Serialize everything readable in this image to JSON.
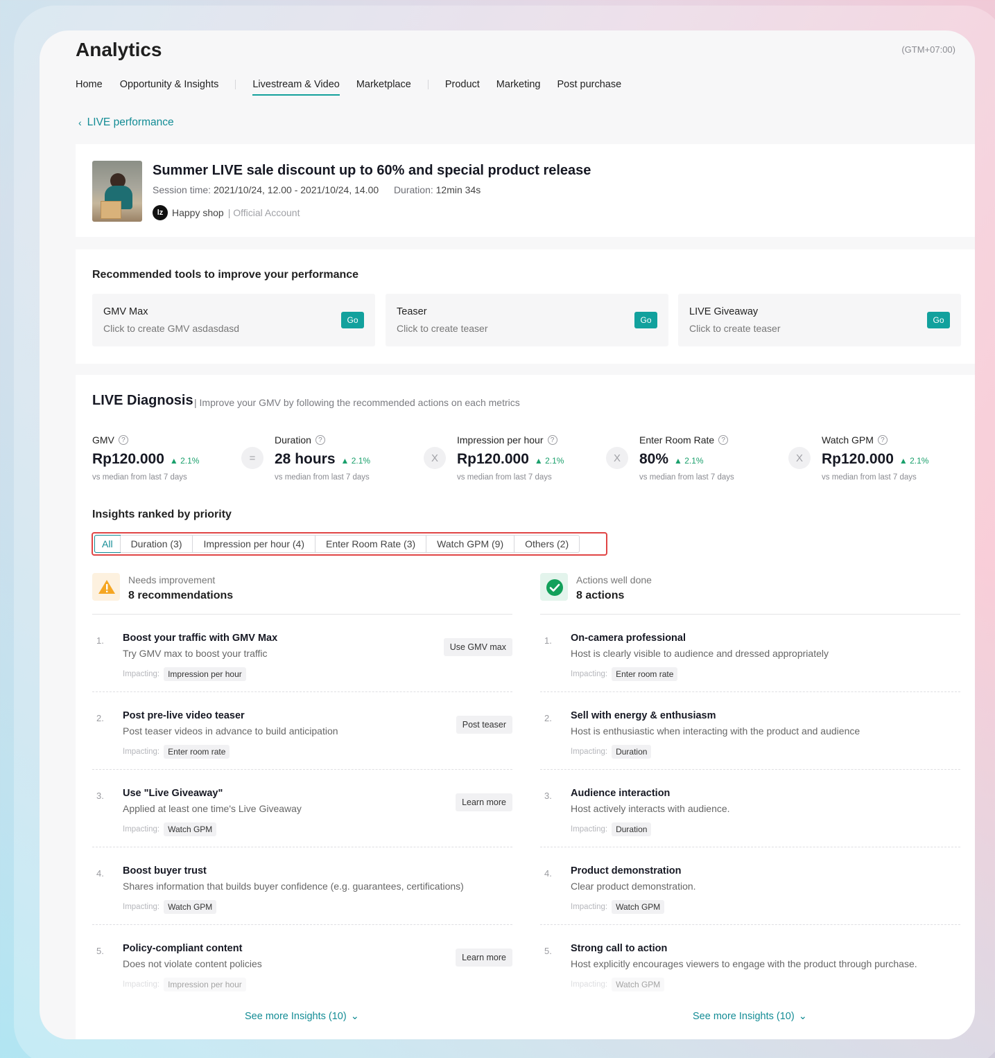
{
  "app": {
    "title": "Analytics",
    "timezone": "(GTM+07:00)"
  },
  "nav": {
    "home": "Home",
    "opportunity": "Opportunity & Insights",
    "livestream": "Livestream & Video",
    "marketplace": "Marketplace",
    "product": "Product",
    "marketing": "Marketing",
    "post_purchase": "Post purchase",
    "active": "Livestream & Video"
  },
  "back": {
    "label": "LIVE performance"
  },
  "session": {
    "title": "Summer LIVE sale discount up to 60% and special product release",
    "time_label": "Session time:",
    "time_value": "2021/10/24, 12.00 - 2021/10/24, 14.00",
    "duration_label": "Duration:",
    "duration_value": "12min 34s",
    "shop_logo": "lz",
    "shop_name": "Happy shop",
    "shop_type": "| Official Account"
  },
  "tools": {
    "title": "Recommended tools to improve your performance",
    "items": [
      {
        "name": "GMV Max",
        "desc": "Click to create GMV asdasdasd",
        "button": "Go"
      },
      {
        "name": "Teaser",
        "desc": "Click to create teaser",
        "button": "Go"
      },
      {
        "name": "LIVE Giveaway",
        "desc": "Click to create teaser",
        "button": "Go"
      }
    ]
  },
  "diagnosis": {
    "title": "LIVE Diagnosis",
    "subtitle": "| Improve your GMV by following the recommended actions on each metrics",
    "metrics": [
      {
        "label": "GMV",
        "value": "Rp120.000",
        "change": "▲ 2.1%",
        "note": "vs median from last 7 days"
      },
      {
        "label": "Duration",
        "value": "28 hours",
        "change": "▲ 2.1%",
        "note": "vs median from last 7 days"
      },
      {
        "label": "Impression per hour",
        "value": "Rp120.000",
        "change": "▲ 2.1%",
        "note": "vs median from last 7 days"
      },
      {
        "label": "Enter Room Rate",
        "value": "80%",
        "change": "▲ 2.1%",
        "note": "vs median from last 7 days"
      },
      {
        "label": "Watch GPM",
        "value": "Rp120.000",
        "change": "▲ 2.1%",
        "note": "vs median from last 7 days"
      }
    ],
    "operators": [
      "=",
      "X",
      "X",
      "X"
    ],
    "help_icon": "?"
  },
  "insights": {
    "title": "Insights ranked by priority",
    "filters": [
      "All",
      "Duration (3)",
      "Impression per hour (4)",
      "Enter Room Rate (3)",
      "Watch GPM (9)",
      "Others (2)"
    ],
    "impacting_label": "Impacting:",
    "left": {
      "sub": "Needs improvement",
      "count": "8 recommendations",
      "items": [
        {
          "num": "1.",
          "title": "Boost your traffic with GMV Max",
          "desc": "Try GMV max to boost your traffic",
          "tag": "Impression per hour",
          "button": "Use GMV max"
        },
        {
          "num": "2.",
          "title": "Post pre-live video teaser",
          "desc": "Post teaser videos in advance to build anticipation",
          "tag": "Enter room rate",
          "button": "Post teaser"
        },
        {
          "num": "3.",
          "title": "Use \"Live Giveaway\"",
          "desc": "Applied at least one time's Live Giveaway",
          "tag": "Watch GPM",
          "button": "Learn more"
        },
        {
          "num": "4.",
          "title": "Boost buyer trust",
          "desc": "Shares information that builds buyer confidence (e.g. guarantees, certifications)",
          "tag": "Watch GPM",
          "button": ""
        },
        {
          "num": "5.",
          "title": "Policy-compliant content",
          "desc": "Does not violate content policies",
          "tag": "Impression per hour",
          "button": "Learn more"
        }
      ],
      "see_more": "See more Insights (10)"
    },
    "right": {
      "sub": "Actions well done",
      "count": "8 actions",
      "items": [
        {
          "num": "1.",
          "title": "On-camera professional",
          "desc": "Host is clearly visible to audience and dressed appropriately",
          "tag": "Enter room rate"
        },
        {
          "num": "2.",
          "title": "Sell with energy & enthusiasm",
          "desc": "Host is enthusiastic when interacting with the product and audience",
          "tag": "Duration"
        },
        {
          "num": "3.",
          "title": "Audience interaction",
          "desc": "Host actively interacts with audience.",
          "tag": "Duration"
        },
        {
          "num": "4.",
          "title": "Product demonstration",
          "desc": "Clear product demonstration.",
          "tag": "Watch GPM"
        },
        {
          "num": "5.",
          "title": "Strong call to action",
          "desc": "Host explicitly encourages viewers to engage with the product through purchase.",
          "tag": "Watch GPM"
        }
      ],
      "see_more": "See more Insights (10)"
    }
  },
  "icons": {
    "back": "chevron-left-icon",
    "help": "question-circle-icon",
    "warn": "warning-icon",
    "ok": "check-circle-icon",
    "expand": "chevron-down-icon"
  },
  "colors": {
    "accent": "#13a09b",
    "link": "#138c95",
    "positive": "#1aa06c",
    "highlight_border": "#e04444"
  }
}
